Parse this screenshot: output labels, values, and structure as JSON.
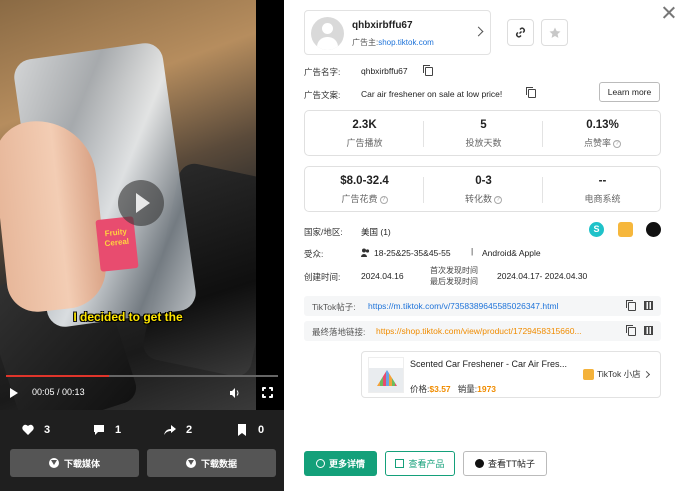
{
  "video": {
    "caption": "I decided to get the",
    "product_label": "Fruity Cereal",
    "current_time": "00:05",
    "duration": "00:13",
    "progress": 0.38
  },
  "engagement": {
    "likes": "3",
    "comments": "1",
    "shares": "2",
    "saves": "0"
  },
  "left_buttons": {
    "download_media": "下载媒体",
    "download_data": "下载数据"
  },
  "advertiser": {
    "name": "qhbxirbffu67",
    "owner_label": "广告主:",
    "owner_link": "shop.tiktok.com"
  },
  "ad_info": {
    "name_label": "广告名字:",
    "name_value": "qhbxirbffu67",
    "copy_label": "广告文案:",
    "copy_value": "Car air freshener on sale at low price!",
    "learn_more": "Learn more"
  },
  "metrics_top": [
    {
      "value": "2.3K",
      "label": "广告播放"
    },
    {
      "value": "5",
      "label": "投放天数"
    },
    {
      "value": "0.13%",
      "label": "点赞率"
    }
  ],
  "metrics_bottom": [
    {
      "value": "$8.0-32.4",
      "label": "广告花费"
    },
    {
      "value": "0-3",
      "label": "转化数"
    },
    {
      "value": "--",
      "label": "电商系统"
    }
  ],
  "details": {
    "region_label": "国家/地区:",
    "region_value": "美国 (1)",
    "audience_label": "受众:",
    "audience_age": "18-25&25-35&45-55",
    "audience_os": "Android& Apple",
    "created_label": "创建时间:",
    "created_value": "2024.04.16",
    "first_seen_label": "首次发现时间",
    "last_seen_label": "最后发现时间",
    "seen_range": "2024.04.17- 2024.04.30"
  },
  "links": {
    "tiktok_post_label": "TikTok帖子:",
    "tiktok_post_url": "https://m.tiktok.com/v/7358389645585026347.html",
    "landing_label": "最终落地链接:",
    "landing_url": "https://shop.tiktok.com/view/product/1729458315660..."
  },
  "product": {
    "title": "Scented Car Freshener - Car Air Fres...",
    "price_label": "价格:",
    "price": "$3.57",
    "sales_label": "销量:",
    "sales": "1973",
    "shop": "TikTok 小店"
  },
  "actions": {
    "more_details": "更多详情",
    "view_product": "查看产品",
    "view_tt_post": "查看TT帖子"
  },
  "colors": {
    "accent": "#14a07a",
    "link": "#1e73d9",
    "landing_link": "#f08c00",
    "progress": "#e0352b"
  }
}
